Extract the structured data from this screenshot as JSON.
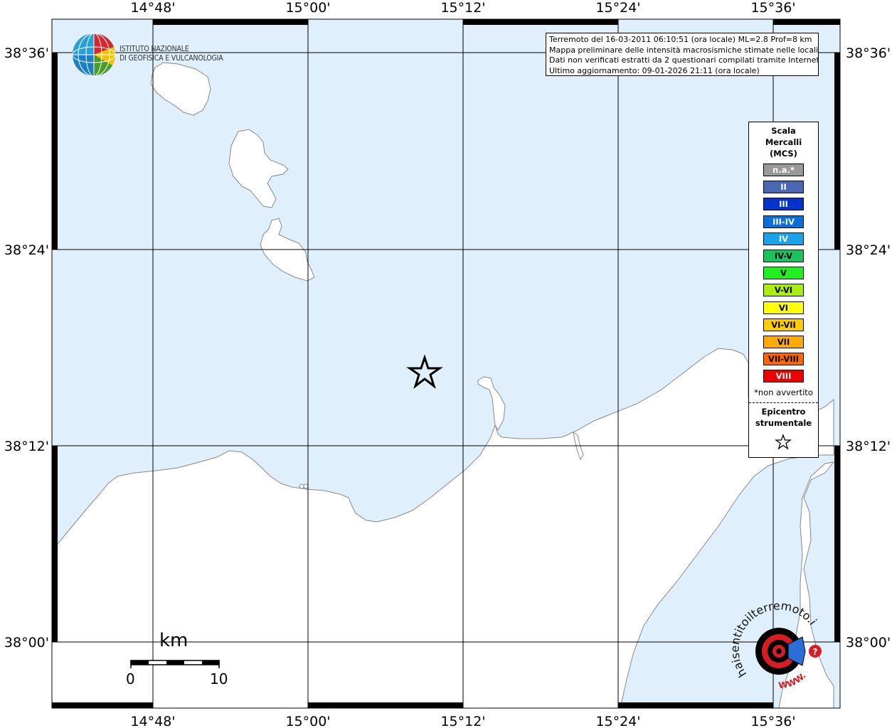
{
  "header": {
    "line1": "Terremoto del 16-03-2011 06:10:51 (ora locale) ML=2.8 Prof=8 km",
    "line2": "Mappa preliminare delle intensità macrosismiche stimate nelle località",
    "line3": "Dati non verificati estratti da 2 questionari compilati tramite Internet.",
    "line4": "Ultimo aggiornamento: 09-01-2026 21:11 (ora locale)"
  },
  "institute": {
    "line1": "ISTITUTO NAZIONALE",
    "line2": "DI GEOFISICA E VULCANOLOGIA"
  },
  "lon_labels": [
    "14°48'",
    "15°00'",
    "15°12'",
    "15°24'",
    "15°36'"
  ],
  "lat_labels": [
    "38°36'",
    "38°24'",
    "38°12'",
    "38°00'"
  ],
  "legend": {
    "title": [
      "Scala",
      "Mercalli",
      "(MCS)"
    ],
    "scale": [
      {
        "label": "n.a.*",
        "color": "#999999",
        "text": "#ffffff"
      },
      {
        "label": "II",
        "color": "#4a67b3",
        "text": "#ffffff"
      },
      {
        "label": "III",
        "color": "#0033cc",
        "text": "#ffffff"
      },
      {
        "label": "III-IV",
        "color": "#0a6fd8",
        "text": "#ffffff"
      },
      {
        "label": "IV",
        "color": "#1aa3ea",
        "text": "#ffffff"
      },
      {
        "label": "IV-V",
        "color": "#19c45f",
        "text": "#000000"
      },
      {
        "label": "V",
        "color": "#22ee22",
        "text": "#000000"
      },
      {
        "label": "V-VI",
        "color": "#aaee11",
        "text": "#000000"
      },
      {
        "label": "VI",
        "color": "#ffff00",
        "text": "#000000"
      },
      {
        "label": "VI-VII",
        "color": "#ffcc00",
        "text": "#000000"
      },
      {
        "label": "VII",
        "color": "#ffaa00",
        "text": "#000000"
      },
      {
        "label": "VII-VIII",
        "color": "#ff6600",
        "text": "#000000"
      },
      {
        "label": "VIII",
        "color": "#ee0000",
        "text": "#ffffff"
      }
    ],
    "not_felt": "*non avvertito",
    "epicenter_title": [
      "Epicentro",
      "strumentale"
    ],
    "epicenter_icon": "star-icon"
  },
  "scale_bar": {
    "unit": "km",
    "min": "0",
    "max": "10"
  },
  "site_logo": {
    "text": "haisentitoilterremoto.it",
    "www": "WWW.",
    "icon": "target-logo-icon"
  },
  "colors": {
    "sea": "#dff0fc",
    "land": "#ffffff",
    "coast": "#888888"
  }
}
